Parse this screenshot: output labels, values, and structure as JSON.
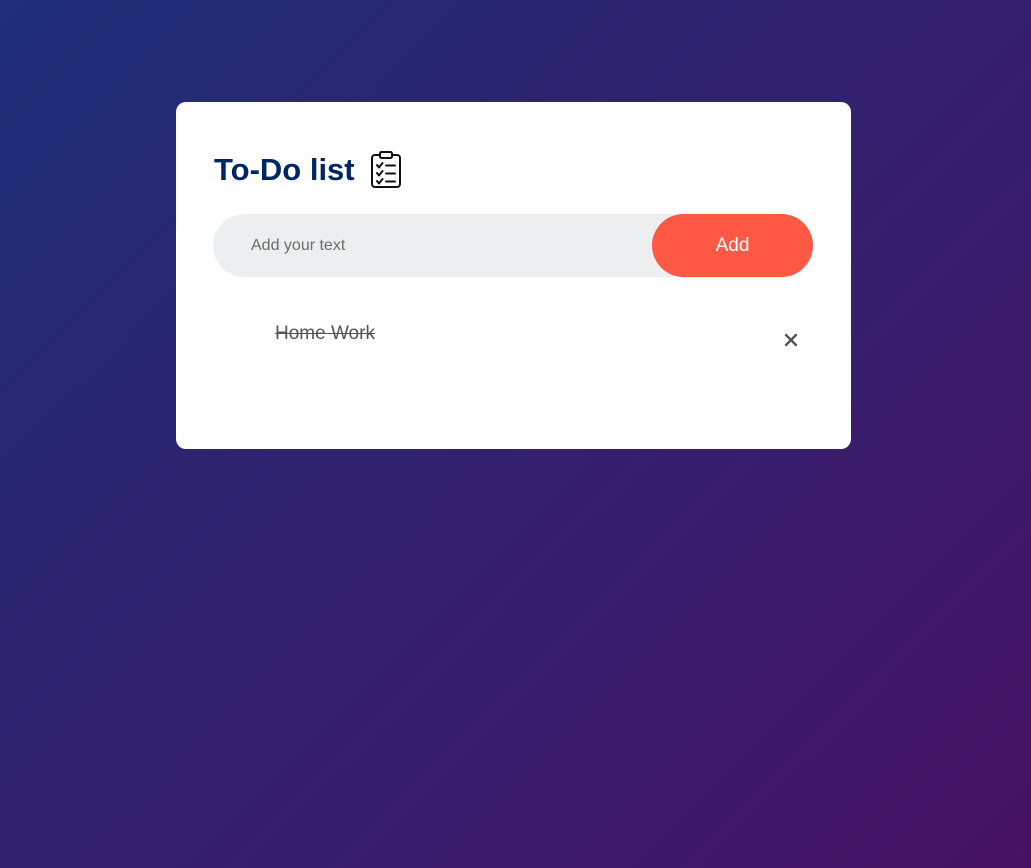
{
  "app": {
    "title": "To-Do list",
    "title_icon": "clipboard-checklist-icon"
  },
  "input": {
    "value": "",
    "placeholder": "Add your text"
  },
  "add_button": {
    "label": "Add"
  },
  "tasks": [
    {
      "text": "Home Work",
      "checked": true,
      "remove_icon": "close-icon"
    }
  ],
  "colors": {
    "title": "#002765",
    "add_button": "#ff5945",
    "input_background": "#edeef0",
    "task_text": "#555555",
    "background_start": "#1f2f78",
    "background_end": "#461162"
  }
}
